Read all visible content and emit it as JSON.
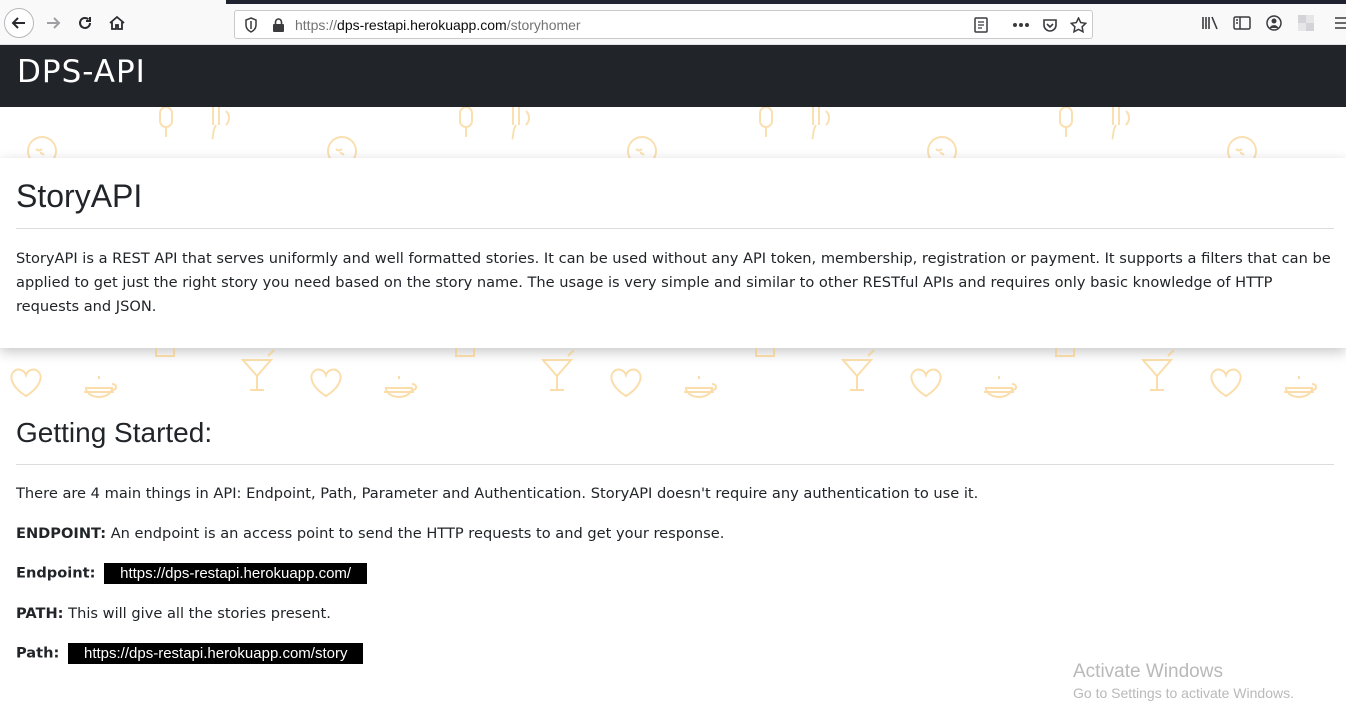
{
  "browser": {
    "url_prefix": "https://",
    "url_host": "dps-restapi.herokuapp.com",
    "url_path": "/storyhomer",
    "icons": [
      "back-icon",
      "forward-icon",
      "reload-icon",
      "home-icon",
      "shield-icon",
      "lock-icon",
      "reader-view-icon",
      "more-icon",
      "pocket-icon",
      "bookmark-star-icon",
      "library-icon",
      "sidebar-icon",
      "account-icon",
      "extension-icon",
      "menu-icon"
    ]
  },
  "header": {
    "brand": "DPS-API"
  },
  "intro": {
    "title": "StoryAPI",
    "body": "StoryAPI is a REST API that serves uniformly and well formatted stories. It can be used without any API token, membership, registration or payment. It supports a filters that can be applied to get just the right story you need based on the story name. The usage is very simple and similar to other RESTful APIs and requires only basic knowledge of HTTP requests and JSON."
  },
  "getting_started": {
    "title": "Getting Started:",
    "summary": "There are 4 main things in API: Endpoint, Path, Parameter and Authentication. StoryAPI doesn't require any authentication to use it.",
    "endpoint_heading": "ENDPOINT:",
    "endpoint_desc": "An endpoint is an access point to send the HTTP requests to and get your response.",
    "endpoint_label": "Endpoint:",
    "endpoint_value": "https://dps-restapi.herokuapp.com/",
    "path_heading": "PATH:",
    "path_desc": "This will give all the stories present.",
    "path_label": "Path:",
    "path_value": "https://dps-restapi.herokuapp.com/story"
  },
  "watermark": {
    "title": "Activate Windows",
    "subtitle": "Go to Settings to activate Windows."
  },
  "colors": {
    "header_bg": "#212529",
    "pattern": "#f7c873",
    "code_bg": "#000000"
  }
}
